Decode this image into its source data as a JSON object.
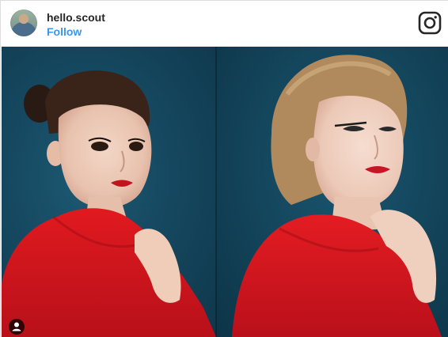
{
  "post": {
    "username": "hello.scout",
    "follow_label": "Follow",
    "accent_color": "#3897f0",
    "icons": {
      "brand": "instagram-icon",
      "avatar": "avatar",
      "tagged_people": "user-tag-icon"
    }
  }
}
